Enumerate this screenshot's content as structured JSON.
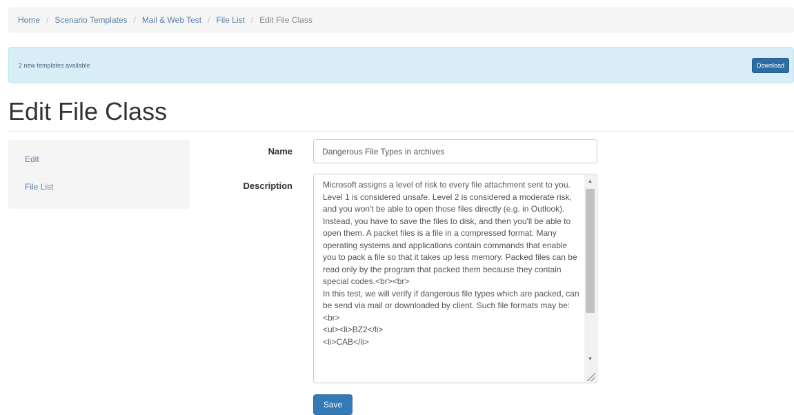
{
  "breadcrumb": {
    "items": [
      "Home",
      "Scenario Templates",
      "Mail & Web Test",
      "File List"
    ],
    "active": "Edit File Class",
    "separator": "/"
  },
  "alert": {
    "message": "2 new templates available",
    "button_label": "Download"
  },
  "page": {
    "title": "Edit File Class"
  },
  "side_nav": {
    "items": [
      "Edit",
      "File List"
    ]
  },
  "form": {
    "name_label": "Name",
    "name_value": "Dangerous File Types in archives",
    "description_label": "Description",
    "description_value": "Microsoft assigns a level of risk to every file attachment sent to you. Level 1 is considered unsafe. Level 2 is considered a moderate risk, and you won't be able to open those files directly (e.g. in Outlook). Instead, you have to save the files to disk, and then you'll be able to open them. A packet files is a file in a compressed format. Many operating systems and applications contain commands that enable you to pack a file so that it takes up less memory. Packed files can be read only by the program that packed them because they contain special codes.<br><br>\nIn this test, we will verify if dangerous file types which are packed, can be send via mail or downloaded by client. Such file formats may be:<br>\n<ul><li>BZ2</li>\n<li>CAB</li>",
    "save_label": "Save"
  },
  "colors": {
    "link": "#5b7fa7",
    "primary": "#337ab7",
    "alert_bg": "#d9edf7"
  }
}
